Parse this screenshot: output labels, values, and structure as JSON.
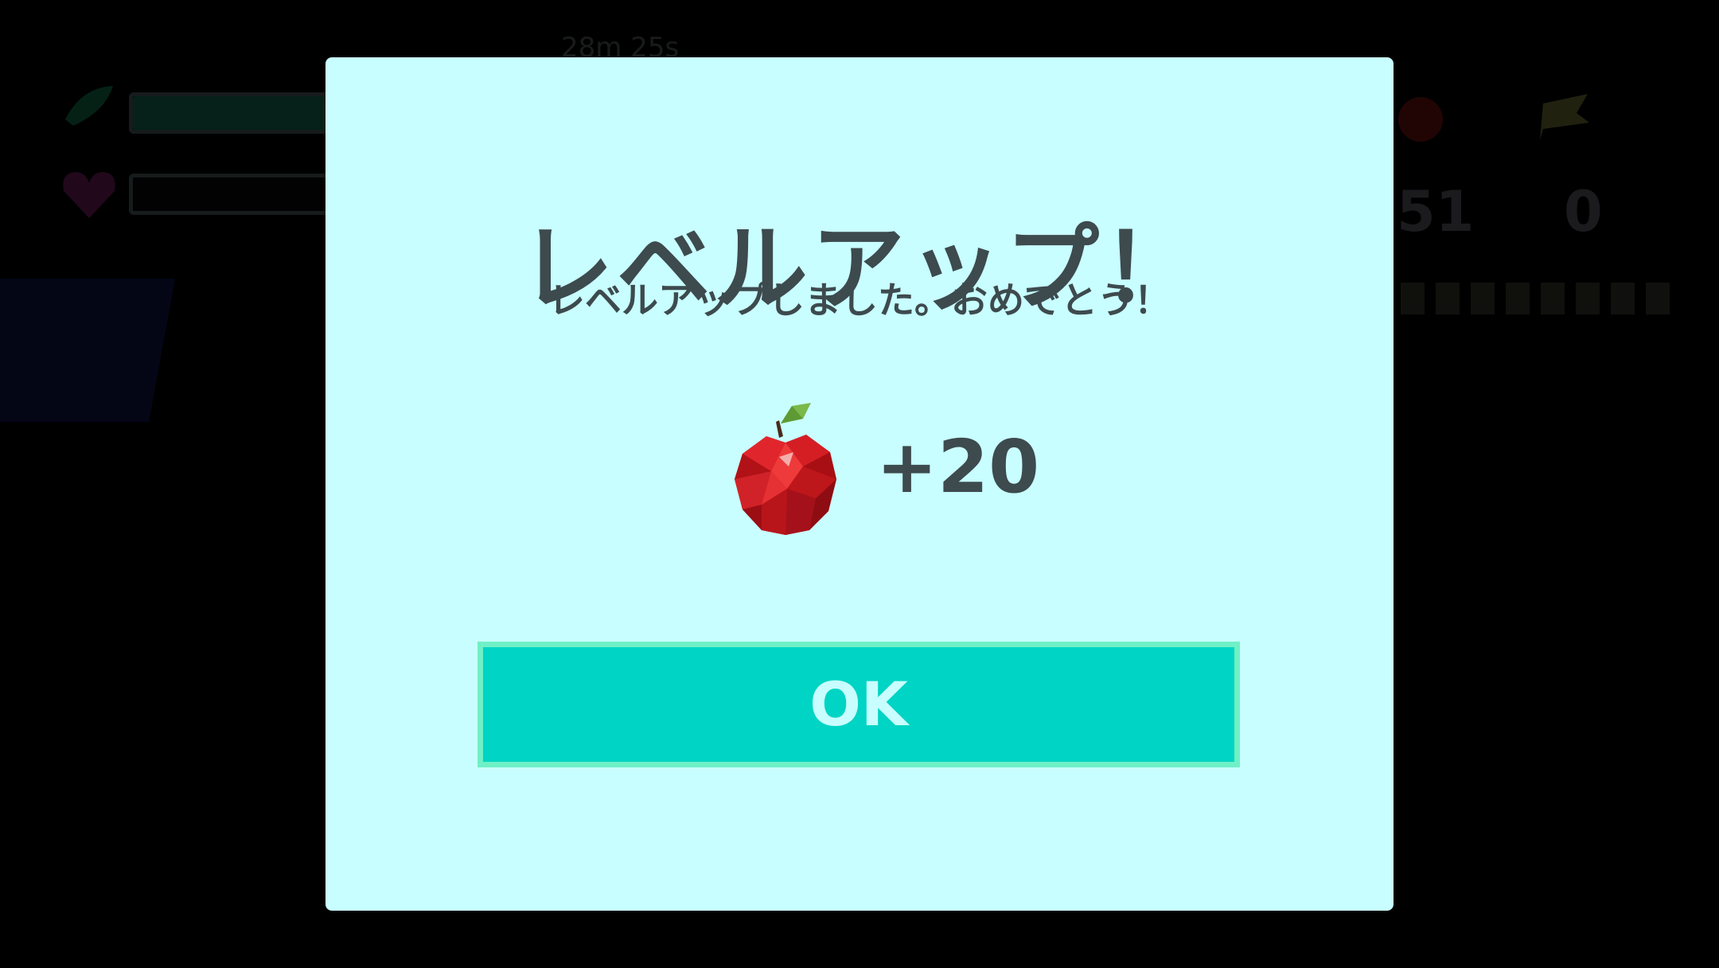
{
  "background_hud": {
    "timer": "28m 25s",
    "stat_value_1": "51",
    "stat_value_2": "0",
    "icons": [
      "leaf-icon",
      "heart-icon",
      "apple-icon",
      "flag-icon"
    ]
  },
  "dialog": {
    "title": "レベルアップ！",
    "subtitle": "レベルアップしました。おめでとう！",
    "reward": {
      "icon": "apple-icon",
      "amount": "+20"
    },
    "ok_label": "OK"
  },
  "colors": {
    "dialog_bg": "#c8feff",
    "text": "#3d4a4e",
    "button_bg": "#00d4c4",
    "button_border": "#6ff0c6"
  }
}
